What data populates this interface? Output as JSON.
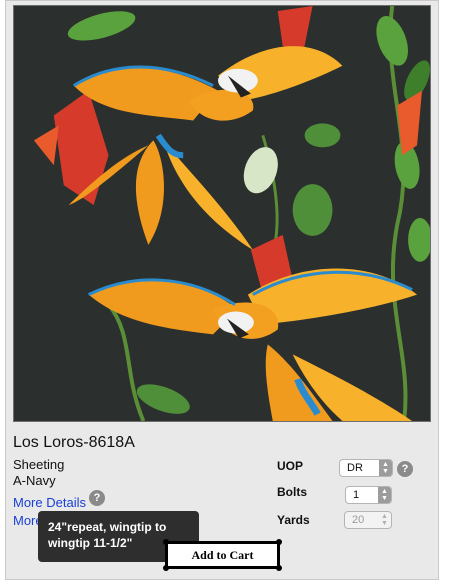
{
  "product": {
    "title": "Los Loros-8618A",
    "category": "Sheeting",
    "color": "A-Navy",
    "more_details": "More Details",
    "more_options": "More Options",
    "image_icon": "parrot-print-swatch"
  },
  "order": {
    "uop_label": "UOP",
    "uop_value": "DR",
    "bolts_label": "Bolts",
    "bolts_value": "1",
    "yards_label": "Yards",
    "yards_value": "20",
    "add_to_cart": "Add to Cart"
  },
  "tooltip": {
    "line1": "24\"repeat, wingtip to",
    "line2": "wingtip 11-1/2\""
  },
  "icons": {
    "help": "?",
    "stepper": "⌃⌄"
  },
  "colors": {
    "background": "#2b2f2d",
    "parrot_orange": "#f09a1e",
    "parrot_red": "#e94b2a",
    "leaf_green": "#4f8f3a",
    "link_blue": "#1a3fd6"
  }
}
